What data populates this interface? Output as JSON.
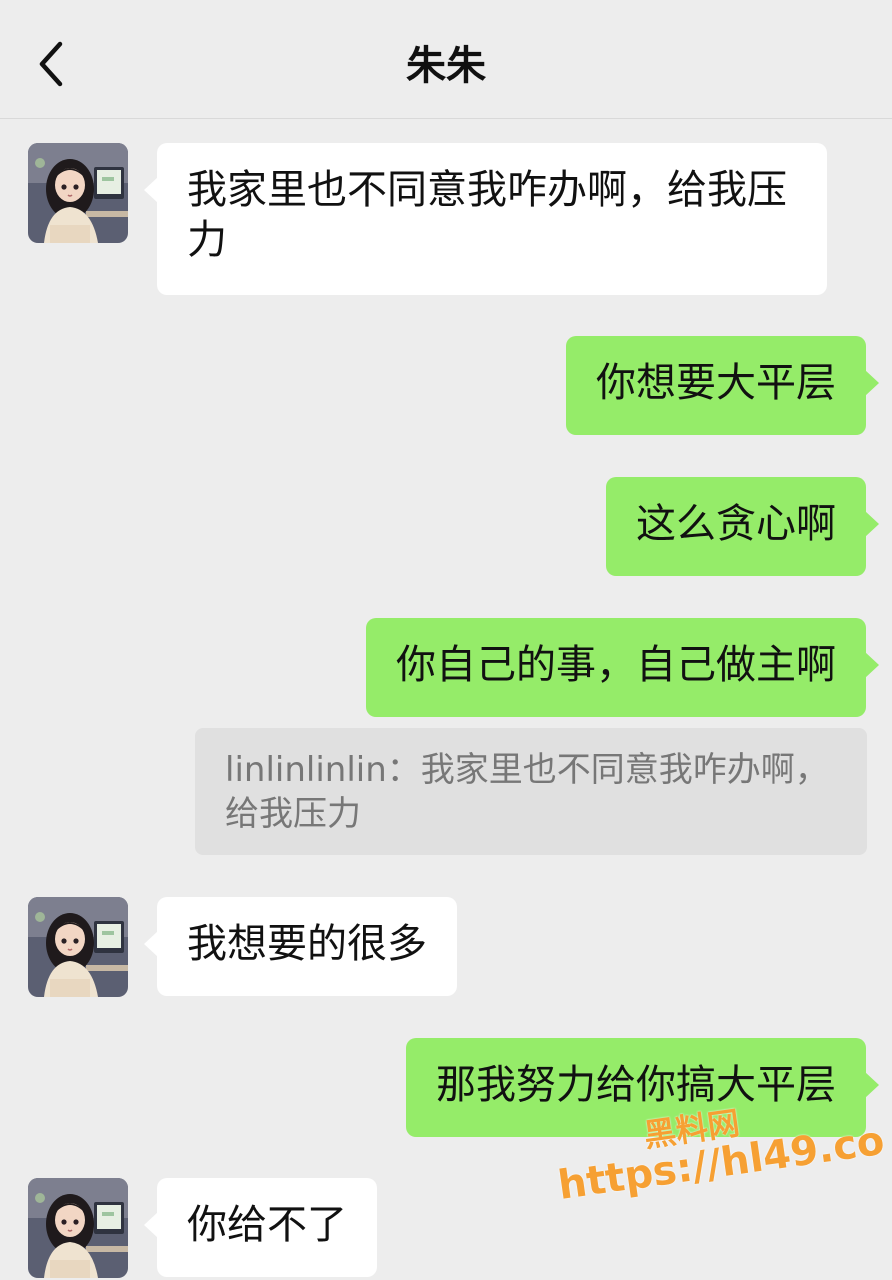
{
  "header": {
    "title": "朱朱"
  },
  "messages": [
    {
      "side": "in",
      "text": "我家里也不同意我咋办啊，给我压力"
    },
    {
      "side": "out",
      "text": "你想要大平层"
    },
    {
      "side": "out",
      "text": "这么贪心啊"
    },
    {
      "side": "out",
      "text": "你自己的事，自己做主啊"
    },
    {
      "side": "in",
      "text": "我想要的很多"
    },
    {
      "side": "out",
      "text": "那我努力给你搞大平层"
    },
    {
      "side": "in",
      "text": "你给不了"
    }
  ],
  "quote": {
    "text": "linlinlinlin：我家里也不同意我咋办啊，给我压力"
  },
  "watermark": {
    "title": "黑料网",
    "url": "https://hl49.co"
  },
  "colors": {
    "background": "#ededed",
    "outgoing_bubble": "#95ec69",
    "incoming_bubble": "#ffffff",
    "watermark": "#f6a033"
  },
  "icons": {
    "back": "chevron-left-icon",
    "avatar": "girl-at-computer-illustration"
  }
}
